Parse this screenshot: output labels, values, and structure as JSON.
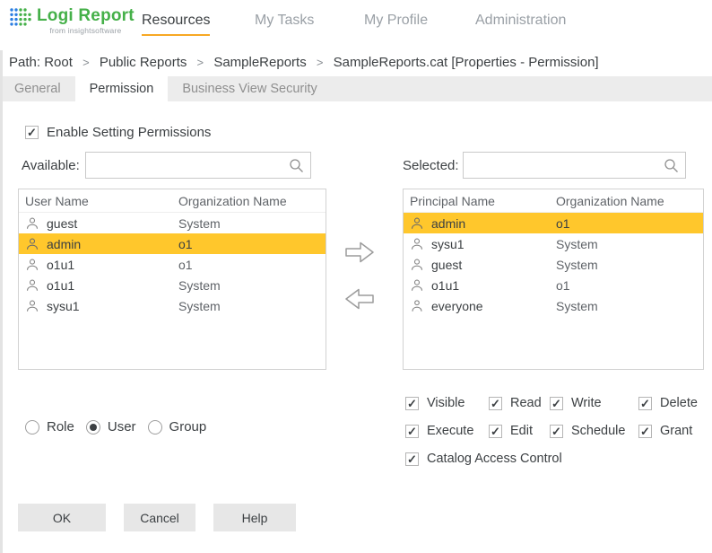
{
  "header": {
    "logo": {
      "title": "Logi Report",
      "tagline": "from insightsoftware"
    },
    "nav": [
      {
        "label": "Resources",
        "active": true
      },
      {
        "label": "My Tasks",
        "active": false
      },
      {
        "label": "My Profile",
        "active": false
      },
      {
        "label": "Administration",
        "active": false
      }
    ]
  },
  "breadcrumb": {
    "prefix": "Path:",
    "separator": ">",
    "segments": [
      "Root",
      "Public Reports",
      "SampleReports",
      "SampleReports.cat [Properties - Permission]"
    ]
  },
  "tabs": [
    {
      "label": "General",
      "active": false
    },
    {
      "label": "Permission",
      "active": true
    },
    {
      "label": "Business View Security",
      "active": false
    }
  ],
  "panel": {
    "enable_permissions": {
      "label": "Enable Setting Permissions",
      "checked": true
    },
    "available": {
      "label": "Available:",
      "columns": [
        "User Name",
        "Organization Name"
      ],
      "rows": [
        {
          "name": "guest",
          "org": "System",
          "selected": false
        },
        {
          "name": "admin",
          "org": "o1",
          "selected": true
        },
        {
          "name": "o1u1",
          "org": "o1",
          "selected": false
        },
        {
          "name": "o1u1",
          "org": "System",
          "selected": false
        },
        {
          "name": "sysu1",
          "org": "System",
          "selected": false
        }
      ]
    },
    "selected": {
      "label": "Selected:",
      "columns": [
        "Principal Name",
        "Organization Name"
      ],
      "rows": [
        {
          "name": "admin",
          "org": "o1",
          "selected": true
        },
        {
          "name": "sysu1",
          "org": "System",
          "selected": false
        },
        {
          "name": "guest",
          "org": "System",
          "selected": false
        },
        {
          "name": "o1u1",
          "org": "o1",
          "selected": false
        },
        {
          "name": "everyone",
          "org": "System",
          "selected": false
        }
      ]
    },
    "principal_type": {
      "options": [
        {
          "label": "Role",
          "selected": false
        },
        {
          "label": "User",
          "selected": true
        },
        {
          "label": "Group",
          "selected": false
        }
      ]
    },
    "permissions": [
      {
        "label": "Visible",
        "checked": true
      },
      {
        "label": "Read",
        "checked": true
      },
      {
        "label": "Write",
        "checked": true
      },
      {
        "label": "Delete",
        "checked": true
      },
      {
        "label": "Execute",
        "checked": true
      },
      {
        "label": "Edit",
        "checked": true
      },
      {
        "label": "Schedule",
        "checked": true
      },
      {
        "label": "Grant",
        "checked": true
      },
      {
        "label": "Catalog Access Control",
        "checked": true
      }
    ],
    "buttons": [
      {
        "label": "OK"
      },
      {
        "label": "Cancel"
      },
      {
        "label": "Help"
      }
    ]
  },
  "colors": {
    "row_highlight": "#FFC72C",
    "nav_underline": "#F7A824",
    "logo_green": "#45B049",
    "logo_blue": "#2A7DE1",
    "tabbar_bg": "#ececec"
  }
}
